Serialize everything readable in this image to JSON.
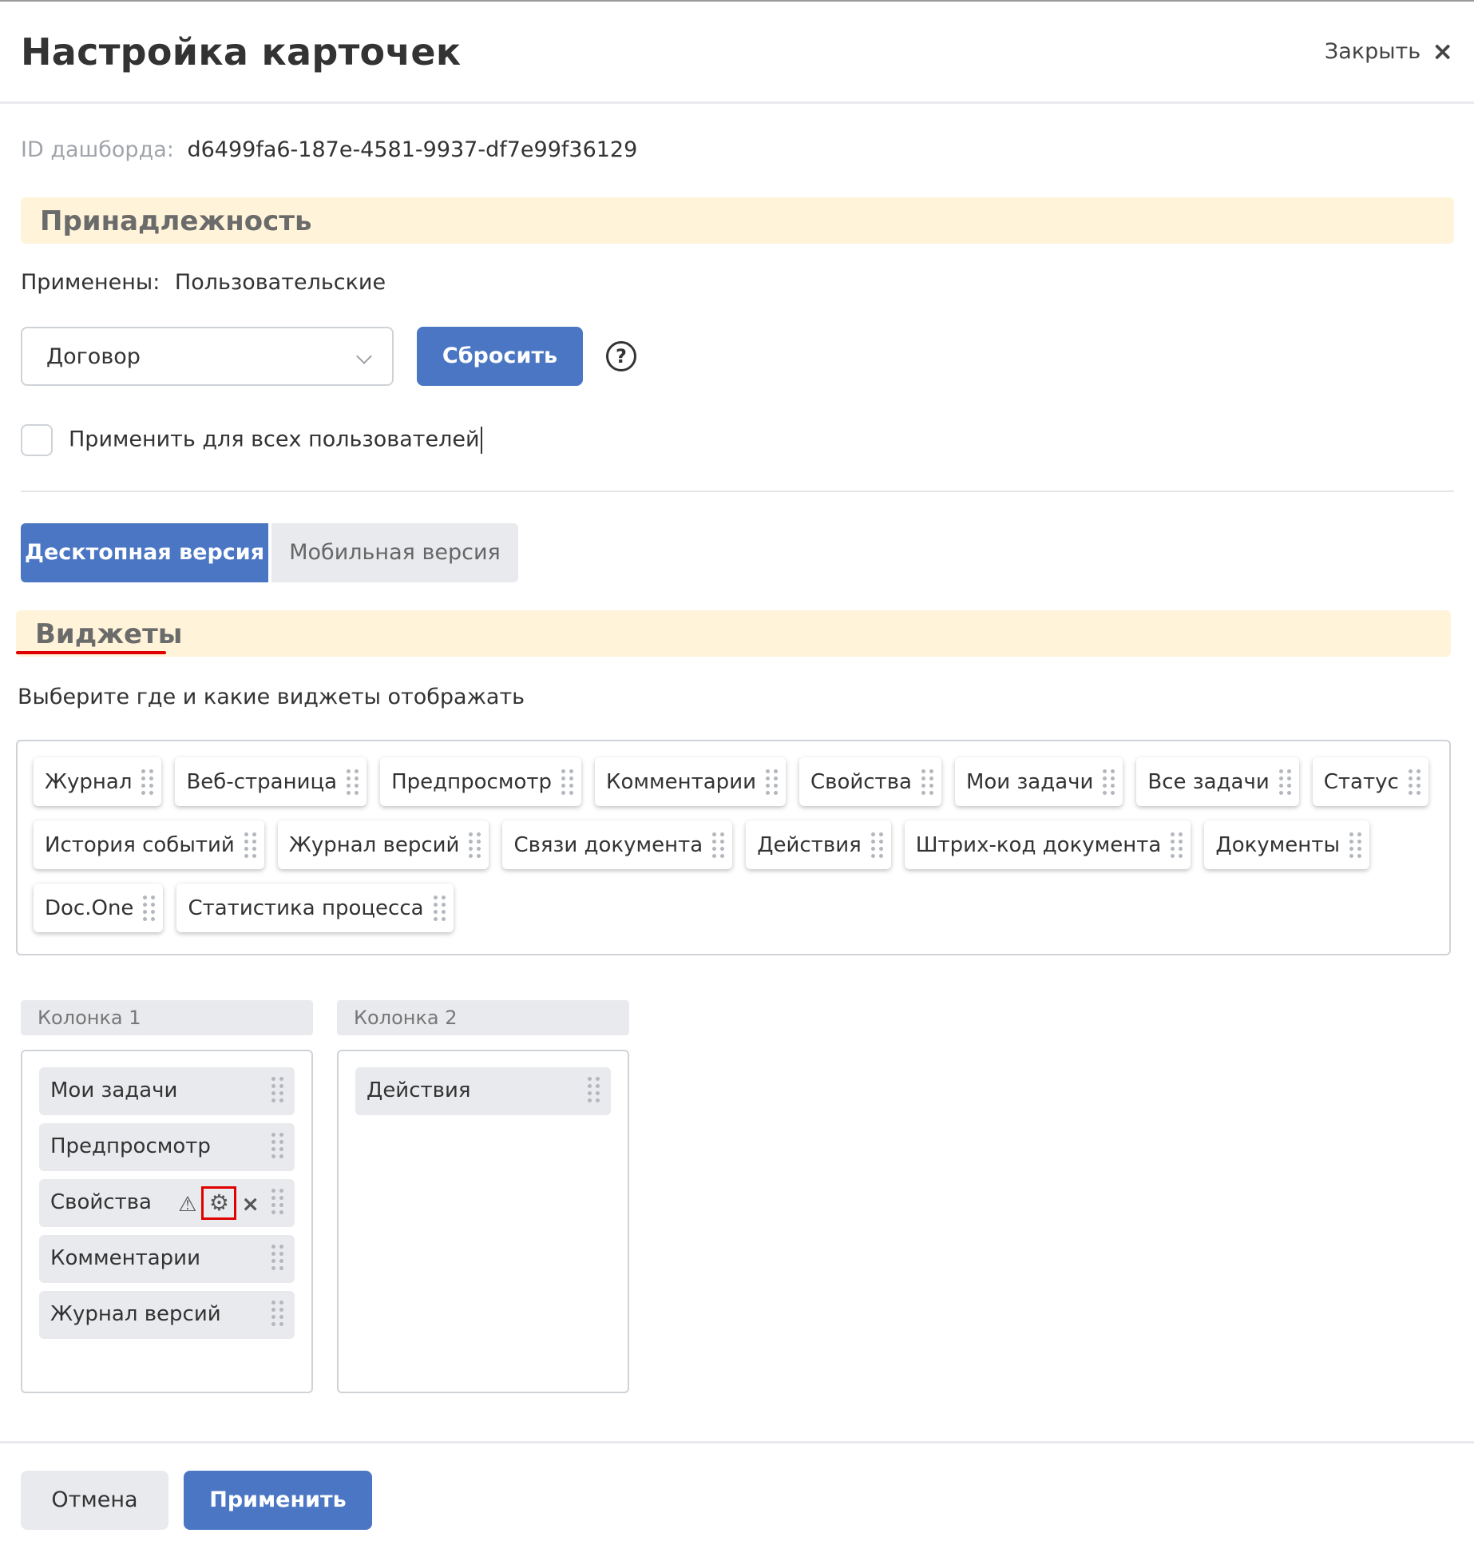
{
  "header": {
    "title": "Настройка карточек",
    "close_label": "Закрыть",
    "close_icon": "×"
  },
  "dashboard": {
    "id_label": "ID дашборда:",
    "id_value": "d6499fa6-187e-4581-9937-df7e99f36129"
  },
  "belonging": {
    "section_title": "Принадлежность",
    "applied_label": "Применены:",
    "applied_value": "Пользовательские",
    "select_value": "Договор",
    "reset_label": "Сбросить",
    "help_icon": "?",
    "apply_all_label": "Применить для всех пользователей",
    "apply_all_checked": false
  },
  "tabs": [
    {
      "label": "Десктопная версия",
      "active": true
    },
    {
      "label": "Мобильная версия",
      "active": false
    }
  ],
  "widgets": {
    "section_title": "Виджеты",
    "instruction": "Выберите где и какие виджеты отображать",
    "pool": [
      "Журнал",
      "Веб-страница",
      "Предпросмотр",
      "Комментарии",
      "Свойства",
      "Мои задачи",
      "Все задачи",
      "Статус",
      "История событий",
      "Журнал версий",
      "Связи документа",
      "Действия",
      "Штрих-код документа",
      "Документы",
      "Doc.One",
      "Статистика процесса"
    ]
  },
  "columns": [
    {
      "header": "Колонка 1",
      "items": [
        "Мои задачи",
        "Предпросмотр",
        "Свойства",
        "Комментарии",
        "Журнал версий"
      ]
    },
    {
      "header": "Колонка 2",
      "items": [
        "Действия"
      ]
    }
  ],
  "item_tools": {
    "warning_icon": "⚠",
    "gear_icon": "⚙",
    "remove_icon": "×"
  },
  "footer": {
    "cancel_label": "Отмена",
    "apply_label": "Применить"
  },
  "colors": {
    "primary": "#4a76c4",
    "section_band": "#fff4d9",
    "highlight_red": "#e00000"
  }
}
